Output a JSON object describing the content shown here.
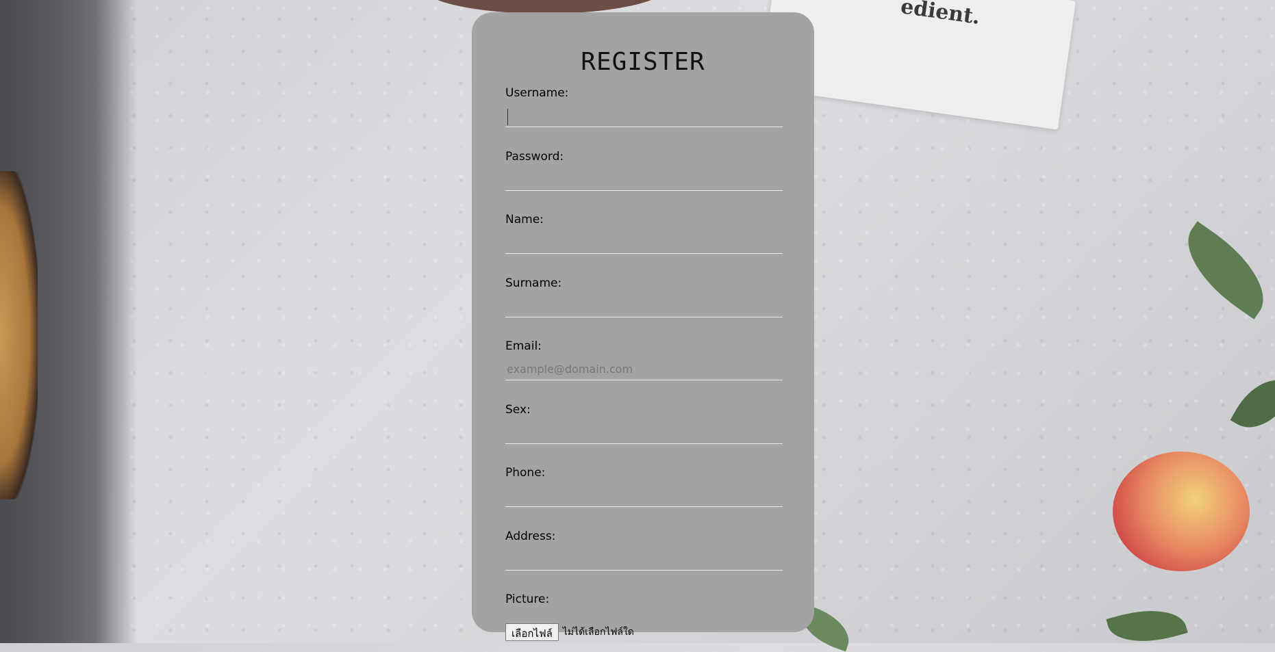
{
  "form": {
    "title": "REGISTER",
    "fields": [
      {
        "label": "Username:",
        "value": "",
        "placeholder": ""
      },
      {
        "label": "Password:",
        "value": "",
        "placeholder": ""
      },
      {
        "label": "Name:",
        "value": "",
        "placeholder": ""
      },
      {
        "label": "Surname:",
        "value": "",
        "placeholder": ""
      },
      {
        "label": "Email:",
        "value": "",
        "placeholder": "example@domain.com"
      },
      {
        "label": "Sex:",
        "value": "",
        "placeholder": ""
      },
      {
        "label": "Phone:",
        "value": "",
        "placeholder": ""
      },
      {
        "label": "Address:",
        "value": "",
        "placeholder": ""
      }
    ],
    "picture": {
      "label": "Picture:",
      "button_label": "เลือกไฟล์",
      "status": "ไม่ได้เลือกไฟล์ใด"
    }
  },
  "background": {
    "napkin_text": "edient."
  },
  "colors": {
    "card": "#a3a3a3",
    "underline": "#eaeaea"
  }
}
